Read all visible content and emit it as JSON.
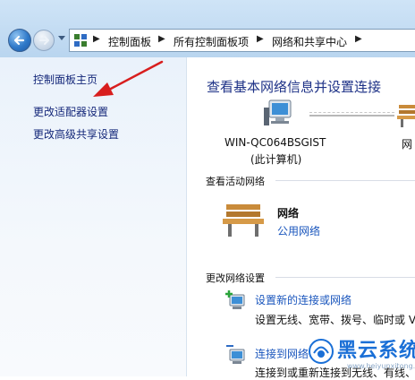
{
  "address_bar": {
    "crumbs": [
      "控制面板",
      "所有控制面板项",
      "网络和共享中心"
    ]
  },
  "left_pane": {
    "links": [
      "控制面板主页",
      "更改适配器设置",
      "更改高级共享设置"
    ]
  },
  "main": {
    "title": "查看基本网络信息并设置连接",
    "computer_name": "WIN-QC064BSGIST",
    "computer_sub": "(此计算机)",
    "network_cut_label": "网",
    "active_networks_heading": "查看活动网络",
    "network_name": "网络",
    "network_type": "公用网络",
    "change_settings_heading": "更改网络设置",
    "tasks": [
      {
        "link": "设置新的连接或网络",
        "desc": "设置无线、宽带、拨号、临时或 V"
      },
      {
        "link": "连接到网络",
        "desc": "连接到或重新连接到无线、有线、"
      }
    ]
  },
  "watermark": {
    "text": "黑云系统",
    "url": "www.heiyunxitong.com"
  },
  "colors": {
    "link": "#1a56bd",
    "title": "#1e3287",
    "left_link": "#15287a",
    "annotation_arrow": "#d81e1e"
  }
}
